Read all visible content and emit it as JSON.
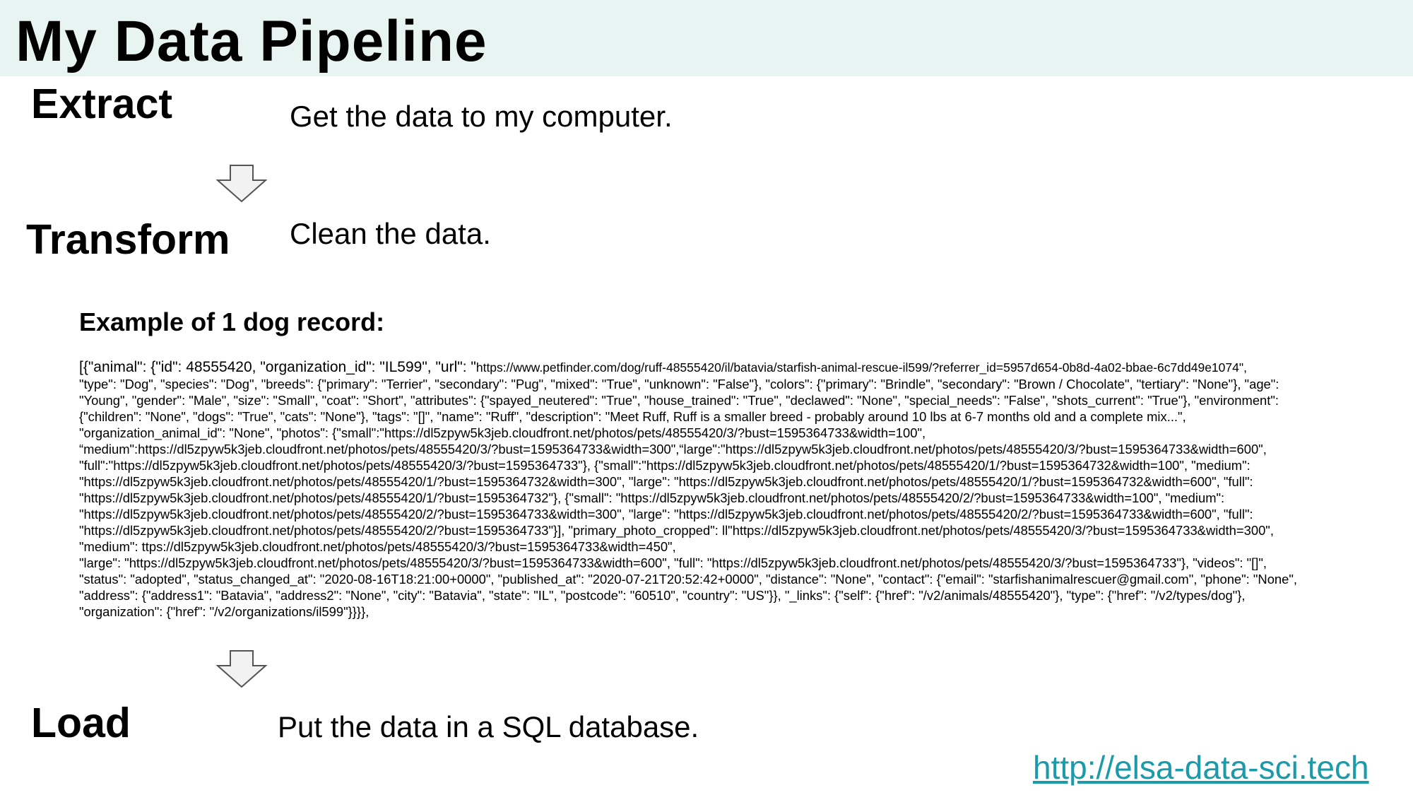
{
  "title": "My Data Pipeline",
  "stages": [
    {
      "label": "Extract",
      "description": "Get the data to my computer."
    },
    {
      "label": "Transform",
      "description": "Clean the data."
    },
    {
      "label": "Load",
      "description": "Put the data in a SQL database."
    }
  ],
  "example": {
    "heading": "Example of 1 dog record:",
    "first_line_prefix": "[{\"animal\": {\"id\": 48555420, \"organization_id\": \"IL599\", \"url\": \"",
    "first_line_url": "https://www.petfinder.com/dog/ruff-48555420/il/batavia/starfish-animal-rescue-il599/?referrer_id=5957d654-0b8d-4a02-bbae-6c7dd49e1074\",",
    "lines": [
      "\"type\": \"Dog\", \"species\": \"Dog\", \"breeds\": {\"primary\": \"Terrier\", \"secondary\": \"Pug\", \"mixed\": \"True\", \"unknown\": \"False\"}, \"colors\": {\"primary\": \"Brindle\", \"secondary\": \"Brown / Chocolate\", \"tertiary\": \"None\"}, \"age\":",
      "\"Young\", \"gender\": \"Male\", \"size\": \"Small\", \"coat\": \"Short\", \"attributes\": {\"spayed_neutered\": \"True\", \"house_trained\": \"True\", \"declawed\": \"None\", \"special_needs\": \"False\", \"shots_current\": \"True\"}, \"environment\":",
      "{\"children\": \"None\", \"dogs\": \"True\", \"cats\": \"None\"}, \"tags\": \"[]\", \"name\": \"Ruff\", \"description\": \"Meet Ruff, Ruff is a smaller breed - probably around 10 lbs at  6-7  months old and a complete mix...\",",
      "\"organization_animal_id\": \"None\", \"photos\": {\"small\":\"https://dl5zpyw5k3jeb.cloudfront.net/photos/pets/48555420/3/?bust=1595364733&width=100\",",
      "“medium\":https://dl5zpyw5k3jeb.cloudfront.net/photos/pets/48555420/3/?bust=1595364733&width=300\",“large\":\"https://dl5zpyw5k3jeb.cloudfront.net/photos/pets/48555420/3/?bust=1595364733&width=600\",",
      "\"full\":\"https://dl5zpyw5k3jeb.cloudfront.net/photos/pets/48555420/3/?bust=1595364733\"}, {\"small\":\"https://dl5zpyw5k3jeb.cloudfront.net/photos/pets/48555420/1/?bust=1595364732&width=100\", \"medium\":",
      "\"https://dl5zpyw5k3jeb.cloudfront.net/photos/pets/48555420/1/?bust=1595364732&width=300\", \"large\": \"https://dl5zpyw5k3jeb.cloudfront.net/photos/pets/48555420/1/?bust=1595364732&width=600\", \"full\":",
      "\"https://dl5zpyw5k3jeb.cloudfront.net/photos/pets/48555420/1/?bust=1595364732\"}, {\"small\": \"https://dl5zpyw5k3jeb.cloudfront.net/photos/pets/48555420/2/?bust=1595364733&width=100\", \"medium\":",
      "\"https://dl5zpyw5k3jeb.cloudfront.net/photos/pets/48555420/2/?bust=1595364733&width=300\", \"large\": \"https://dl5zpyw5k3jeb.cloudfront.net/photos/pets/48555420/2/?bust=1595364733&width=600\", \"full\":",
      "\"https://dl5zpyw5k3jeb.cloudfront.net/photos/pets/48555420/2/?bust=1595364733\"}], \"primary_photo_cropped\": ll\"https://dl5zpyw5k3jeb.cloudfront.net/photos/pets/48555420/3/?bust=1595364733&width=300\",",
      "\"medium\": ttps://dl5zpyw5k3jeb.cloudfront.net/photos/pets/48555420/3/?bust=1595364733&width=450\",",
      " \"large\": \"https://dl5zpyw5k3jeb.cloudfront.net/photos/pets/48555420/3/?bust=1595364733&width=600\", \"full\": \"https://dl5zpyw5k3jeb.cloudfront.net/photos/pets/48555420/3/?bust=1595364733\"}, \"videos\": \"[]\",",
      "\"status\": \"adopted\", \"status_changed_at\": \"2020-08-16T18:21:00+0000\", \"published_at\": \"2020-07-21T20:52:42+0000\", \"distance\": \"None\", \"contact\": {\"email\": \"starfishanimalrescuer@gmail.com\", \"phone\": \"None\",",
      "\"address\": {\"address1\": \"Batavia\", \"address2\": \"None\", \"city\": \"Batavia\", \"state\": \"IL\", \"postcode\": \"60510\", \"country\": \"US\"}}, \"_links\": {\"self\": {\"href\": \"/v2/animals/48555420\"}, \"type\": {\"href\": \"/v2/types/dog\"},",
      "\"organization\": {\"href\": \"/v2/organizations/il599\"}}}},"
    ]
  },
  "footer_link": "http://elsa-data-sci.tech",
  "colors": {
    "title_band": "#e8f4f1",
    "link": "#1b9aaa",
    "arrow_fill": "#f2f2f2",
    "arrow_stroke": "#555555"
  },
  "icons": [
    "down-arrow-icon"
  ]
}
